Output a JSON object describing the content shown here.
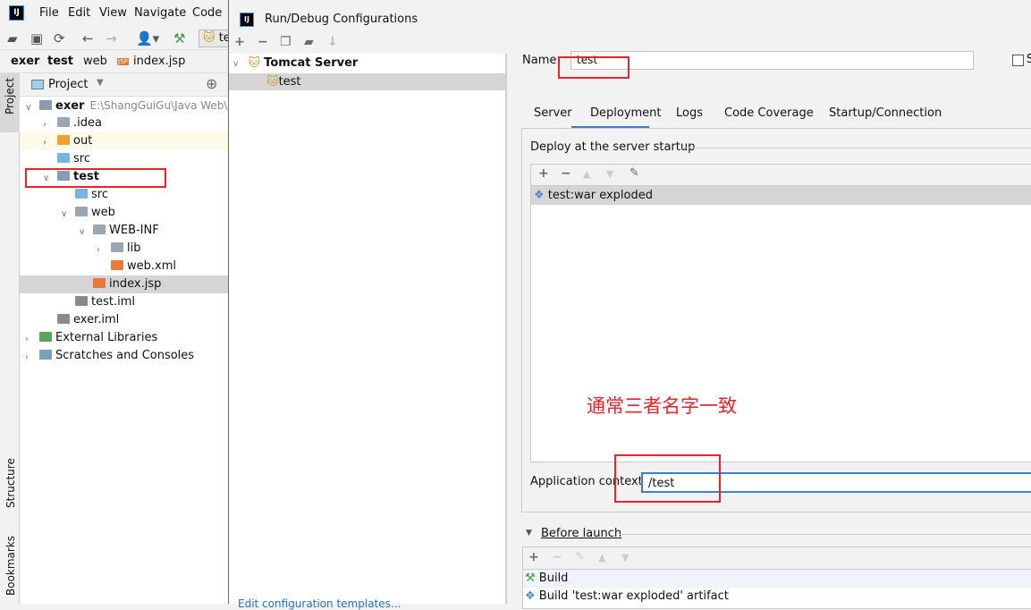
{
  "ide": {
    "menu": [
      "File",
      "Edit",
      "View",
      "Navigate",
      "Code"
    ],
    "breadcrumb": [
      "exer",
      "test",
      "web",
      "index.jsp"
    ],
    "run_config_chip": "te",
    "project_header": "Project",
    "side_tabs": {
      "project": "Project",
      "structure": "Structure",
      "bookmarks": "Bookmarks"
    },
    "tree": [
      {
        "label": "exer",
        "path": "E:\\ShangGuiGu\\Java Web\\E",
        "depth": 0,
        "icon": "module-folder-icon",
        "bold": true,
        "expanded": true
      },
      {
        "label": ".idea",
        "depth": 1,
        "icon": "folder-icon",
        "collapsed": true
      },
      {
        "label": "out",
        "depth": 1,
        "icon": "excluded-folder-icon",
        "collapsed": true,
        "highlight": true
      },
      {
        "label": "src",
        "depth": 1,
        "icon": "source-folder-icon"
      },
      {
        "label": "test",
        "depth": 1,
        "icon": "module-folder-icon",
        "bold": true,
        "expanded": true
      },
      {
        "label": "src",
        "depth": 2,
        "icon": "source-folder-icon"
      },
      {
        "label": "web",
        "depth": 2,
        "icon": "web-folder-icon",
        "expanded": true
      },
      {
        "label": "WEB-INF",
        "depth": 3,
        "icon": "folder-icon",
        "expanded": true
      },
      {
        "label": "lib",
        "depth": 4,
        "icon": "folder-icon",
        "collapsed": true
      },
      {
        "label": "web.xml",
        "depth": 4,
        "icon": "xml-file-icon"
      },
      {
        "label": "index.jsp",
        "depth": 3,
        "icon": "jsp-file-icon",
        "selected": true
      },
      {
        "label": "test.iml",
        "depth": 2,
        "icon": "iml-file-icon"
      },
      {
        "label": "exer.iml",
        "depth": 1,
        "icon": "iml-file-icon"
      },
      {
        "label": "External Libraries",
        "depth": 0,
        "icon": "libraries-icon",
        "collapsed": true
      },
      {
        "label": "Scratches and Consoles",
        "depth": 0,
        "icon": "scratches-icon",
        "collapsed": true
      }
    ]
  },
  "dialog": {
    "title": "Run/Debug Configurations",
    "config_tree": {
      "group": "Tomcat Server",
      "item": "test"
    },
    "edit_templates_link": "Edit configuration templates...",
    "name_label": "Name:",
    "name_value": "test",
    "store_checkbox_label": "S",
    "tabs": [
      "Server",
      "Deployment",
      "Logs",
      "Code Coverage",
      "Startup/Connection"
    ],
    "active_tab": "Deployment",
    "deploy_section": "Deploy at the server startup",
    "deploy_items": [
      "test:war exploded"
    ],
    "app_context_label": "Application context:",
    "app_context_value": "/test",
    "annotation": "通常三者名字一致",
    "before_launch": "Before launch",
    "before_launch_items": [
      "Build",
      "Build 'test:war exploded' artifact"
    ]
  },
  "colors": {
    "accent": "#3d7dc9",
    "annotation": "#e8232a",
    "selection": "#d5d5d5"
  }
}
